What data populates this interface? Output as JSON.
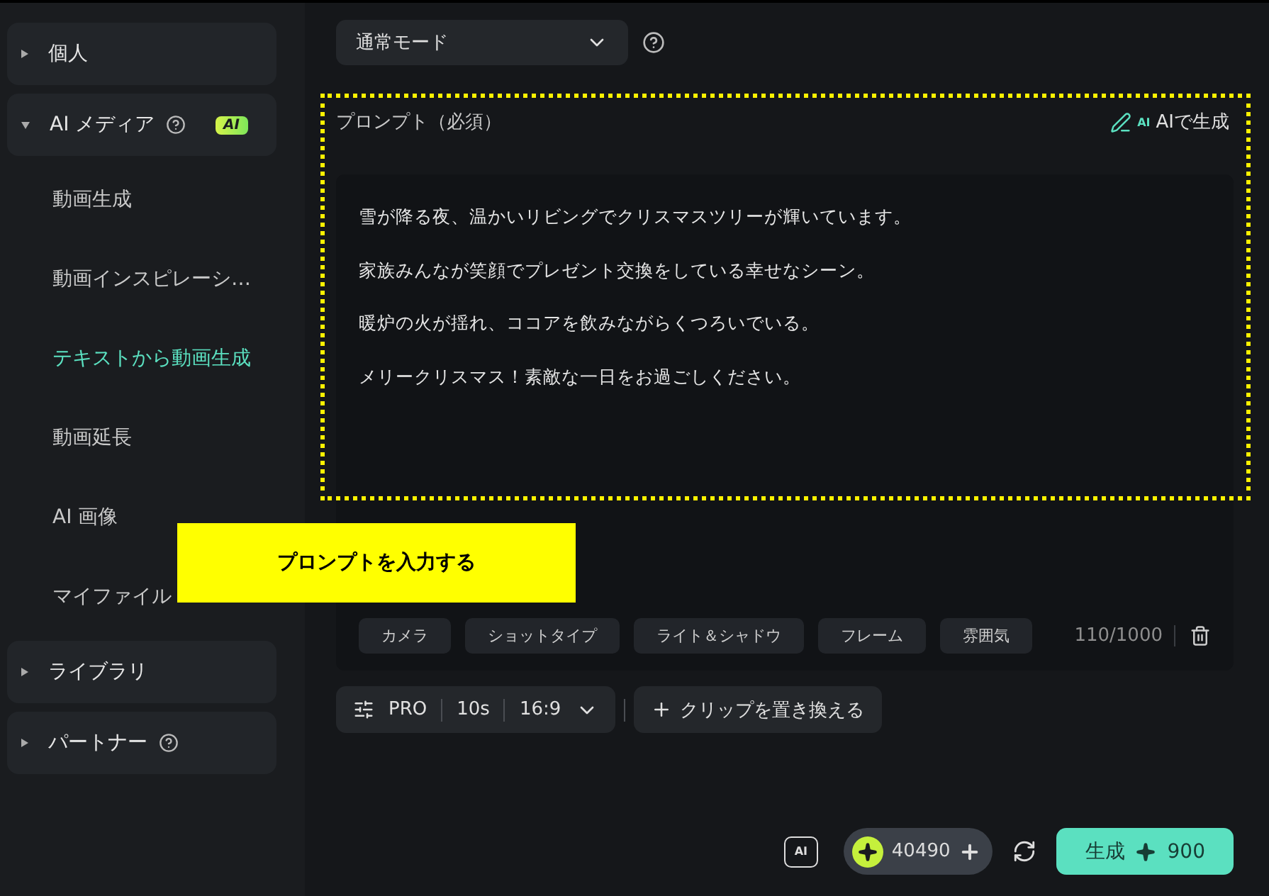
{
  "sidebar": {
    "groups": [
      {
        "label": "個人",
        "expanded": false,
        "help": false
      },
      {
        "label": "AI メディア",
        "expanded": true,
        "help": true,
        "badge": "AI",
        "children": [
          {
            "label": "動画生成",
            "selected": false
          },
          {
            "label": "動画インスピレーシ…",
            "selected": false
          },
          {
            "label": "テキストから動画生成",
            "selected": true
          },
          {
            "label": "動画延長",
            "selected": false
          },
          {
            "label": "AI 画像",
            "selected": false
          },
          {
            "label": "マイファイル",
            "selected": false
          }
        ]
      },
      {
        "label": "ライブラリ",
        "expanded": false,
        "help": false
      },
      {
        "label": "パートナー",
        "expanded": false,
        "help": true
      }
    ]
  },
  "mode": {
    "value": "通常モード"
  },
  "prompt": {
    "label": "プロンプト（必須）",
    "ai_icon_label": "AI",
    "ai_button": "AIで生成",
    "lines": [
      "雪が降る夜、温かいリビングでクリスマスツリーが輝いています。",
      "家族みんなが笑顔でプレゼント交換をしている幸せなシーン。",
      "暖炉の火が揺れ、ココアを飲みながらくつろいでいる。",
      "メリークリスマス！素敵な一日をお過ごしください。"
    ],
    "chips": [
      "カメラ",
      "ショットタイプ",
      "ライト＆シャドウ",
      "フレーム",
      "雰囲気"
    ],
    "count": "110/1000"
  },
  "settings": {
    "quality": "PRO",
    "duration": "10s",
    "ratio": "16:9",
    "replace": "クリップを置き換える"
  },
  "footer": {
    "ai_icon_label": "AI",
    "credits": "40490",
    "generate": "生成",
    "cost": "900"
  },
  "callout": {
    "text": "プロンプトを入力する"
  }
}
